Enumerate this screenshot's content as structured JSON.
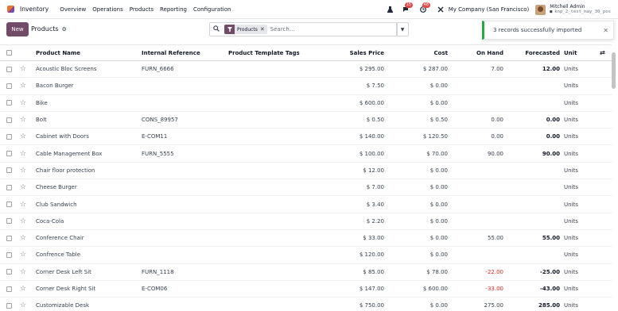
{
  "navbar": {
    "app_name": "Inventory",
    "menu": [
      "Overview",
      "Operations",
      "Products",
      "Reporting",
      "Configuration"
    ],
    "chat_badge": "15",
    "activity_badge": "48",
    "company": "My Company (San Francisco)",
    "user_name": "Mitchell Admin",
    "user_db": "knp_2_test_may_30_pos"
  },
  "control": {
    "new_label": "New",
    "title": "Products",
    "facet_label": "Products",
    "search_placeholder": "Search..."
  },
  "toast": {
    "message": "3 records successfully imported"
  },
  "table": {
    "headers": {
      "name": "Product Name",
      "ref": "Internal Reference",
      "tags": "Product Template Tags",
      "price": "Sales Price",
      "cost": "Cost",
      "onhand": "On Hand",
      "forecast": "Forecasted",
      "unit": "Unit"
    },
    "rows": [
      {
        "name": "Acoustic Bloc Screens",
        "ref": "FURN_6666",
        "price": "$ 295.00",
        "cost": "$ 287.00",
        "onhand": "7.00",
        "forecast": "12.00",
        "unit": "Units"
      },
      {
        "name": "Bacon Burger",
        "ref": "",
        "price": "$ 7.50",
        "cost": "$ 0.00",
        "onhand": "",
        "forecast": "",
        "unit": "Units"
      },
      {
        "name": "Bike",
        "ref": "",
        "price": "$ 600.00",
        "cost": "$ 0.00",
        "onhand": "",
        "forecast": "",
        "unit": "Units"
      },
      {
        "name": "Bolt",
        "ref": "CONS_89957",
        "price": "$ 0.50",
        "cost": "$ 0.50",
        "onhand": "0.00",
        "forecast": "0.00",
        "unit": "Units"
      },
      {
        "name": "Cabinet with Doors",
        "ref": "E-COM11",
        "price": "$ 140.00",
        "cost": "$ 120.50",
        "onhand": "0.00",
        "forecast": "0.00",
        "unit": "Units"
      },
      {
        "name": "Cable Management Box",
        "ref": "FURN_5555",
        "price": "$ 100.00",
        "cost": "$ 70.00",
        "onhand": "90.00",
        "forecast": "90.00",
        "unit": "Units"
      },
      {
        "name": "Chair floor protection",
        "ref": "",
        "price": "$ 12.00",
        "cost": "$ 0.00",
        "onhand": "",
        "forecast": "",
        "unit": "Units"
      },
      {
        "name": "Cheese Burger",
        "ref": "",
        "price": "$ 7.00",
        "cost": "$ 0.00",
        "onhand": "",
        "forecast": "",
        "unit": "Units"
      },
      {
        "name": "Club Sandwich",
        "ref": "",
        "price": "$ 3.40",
        "cost": "$ 0.00",
        "onhand": "",
        "forecast": "",
        "unit": "Units"
      },
      {
        "name": "Coca-Cola",
        "ref": "",
        "price": "$ 2.20",
        "cost": "$ 0.00",
        "onhand": "",
        "forecast": "",
        "unit": "Units"
      },
      {
        "name": "Conference Chair",
        "ref": "",
        "price": "$ 33.00",
        "cost": "$ 0.00",
        "onhand": "55.00",
        "forecast": "55.00",
        "unit": "Units"
      },
      {
        "name": "Confrence Table",
        "ref": "",
        "price": "$ 120.00",
        "cost": "$ 0.00",
        "onhand": "",
        "forecast": "",
        "unit": "Units"
      },
      {
        "name": "Corner Desk Left Sit",
        "ref": "FURN_1118",
        "price": "$ 85.00",
        "cost": "$ 78.00",
        "onhand": "-22.00",
        "forecast": "-25.00",
        "unit": "Units"
      },
      {
        "name": "Corner Desk Right Sit",
        "ref": "E-COM06",
        "price": "$ 147.00",
        "cost": "$ 600.00",
        "onhand": "-33.00",
        "forecast": "-43.00",
        "unit": "Units"
      },
      {
        "name": "Customizable Desk",
        "ref": "",
        "price": "$ 750.00",
        "cost": "$ 0.00",
        "onhand": "275.00",
        "forecast": "285.00",
        "unit": "Units"
      }
    ]
  },
  "colors": {
    "brand": "#714B67",
    "success": "#28a745",
    "negative": "#dc2626",
    "badge": "#e04b4b"
  }
}
